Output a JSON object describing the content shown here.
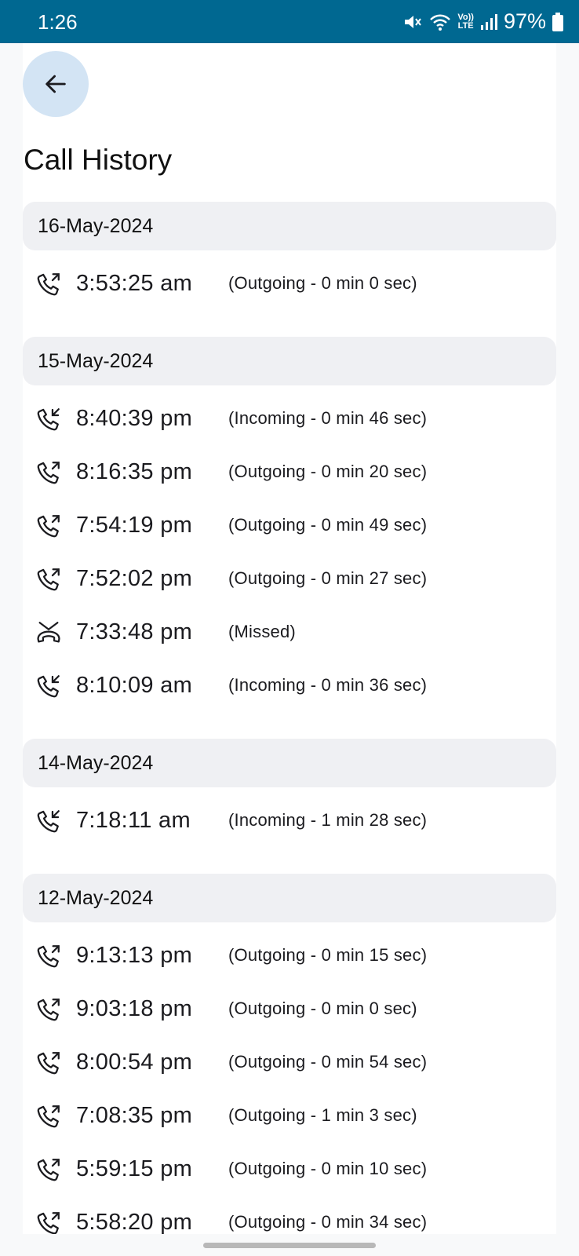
{
  "status_bar": {
    "time": "1:26",
    "battery": "97%",
    "network_label_top": "Vo))",
    "network_label_bottom": "LTE"
  },
  "header": {
    "title": "Call History"
  },
  "groups": [
    {
      "date": "16-May-2024",
      "calls": [
        {
          "type": "outgoing",
          "time": "3:53:25 am",
          "detail": "(Outgoing - 0 min 0 sec)"
        }
      ]
    },
    {
      "date": "15-May-2024",
      "calls": [
        {
          "type": "incoming",
          "time": "8:40:39 pm",
          "detail": "(Incoming - 0 min 46 sec)"
        },
        {
          "type": "outgoing",
          "time": "8:16:35 pm",
          "detail": "(Outgoing - 0 min 20 sec)"
        },
        {
          "type": "outgoing",
          "time": "7:54:19 pm",
          "detail": "(Outgoing - 0 min 49 sec)"
        },
        {
          "type": "outgoing",
          "time": "7:52:02 pm",
          "detail": "(Outgoing - 0 min 27 sec)"
        },
        {
          "type": "missed",
          "time": "7:33:48 pm",
          "detail": "(Missed)"
        },
        {
          "type": "incoming",
          "time": "8:10:09 am",
          "detail": "(Incoming - 0 min 36 sec)"
        }
      ]
    },
    {
      "date": "14-May-2024",
      "calls": [
        {
          "type": "incoming",
          "time": "7:18:11 am",
          "detail": "(Incoming - 1 min 28 sec)"
        }
      ]
    },
    {
      "date": "12-May-2024",
      "calls": [
        {
          "type": "outgoing",
          "time": "9:13:13 pm",
          "detail": "(Outgoing - 0 min 15 sec)"
        },
        {
          "type": "outgoing",
          "time": "9:03:18 pm",
          "detail": "(Outgoing - 0 min 0 sec)"
        },
        {
          "type": "outgoing",
          "time": "8:00:54 pm",
          "detail": "(Outgoing - 0 min 54 sec)"
        },
        {
          "type": "outgoing",
          "time": "7:08:35 pm",
          "detail": "(Outgoing - 1 min 3 sec)"
        },
        {
          "type": "outgoing",
          "time": "5:59:15 pm",
          "detail": "(Outgoing - 0 min 10 sec)"
        },
        {
          "type": "outgoing",
          "time": "5:58:20 pm",
          "detail": "(Outgoing - 0 min 34 sec)"
        }
      ]
    }
  ],
  "icons": {
    "back": "arrow-left-icon",
    "outgoing": "call-outgoing-icon",
    "incoming": "call-incoming-icon",
    "missed": "call-missed-icon"
  },
  "colors": {
    "status_bar": "#006891",
    "back_button_bg": "#d3e4f4",
    "date_header_bg": "#eff0f3"
  }
}
